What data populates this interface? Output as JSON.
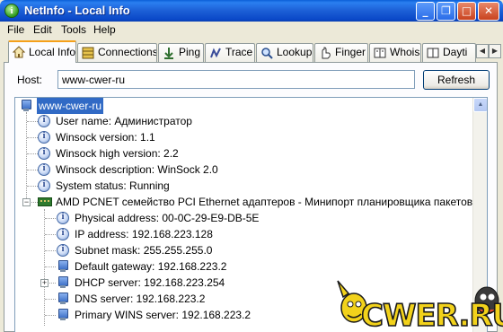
{
  "window": {
    "title": "NetInfo - Local Info"
  },
  "menu": [
    "File",
    "Edit",
    "Tools",
    "Help"
  ],
  "tabs": [
    {
      "label": "Local Info",
      "icon": "home-icon",
      "active": true
    },
    {
      "label": "Connections",
      "icon": "connections-icon"
    },
    {
      "label": "Ping",
      "icon": "ping-icon"
    },
    {
      "label": "Trace",
      "icon": "trace-icon"
    },
    {
      "label": "Lookup",
      "icon": "lookup-icon"
    },
    {
      "label": "Finger",
      "icon": "finger-icon"
    },
    {
      "label": "Whois",
      "icon": "whois-icon"
    },
    {
      "label": "Dayti",
      "icon": "daytime-icon"
    }
  ],
  "host": {
    "label": "Host:",
    "value": "www-cwer-ru"
  },
  "refresh_label": "Refresh",
  "tree": {
    "root": "www-cwer-ru",
    "items": [
      "User name: Администратор",
      "Winsock version: 1.1",
      "Winsock high version: 2.2",
      "Winsock description: WinSock 2.0",
      "System status: Running"
    ],
    "adapter": {
      "label": "AMD PCNET семейство PCI Ethernet адаптеров - Минипорт планировщика пакетов",
      "items": [
        "Physical address: 00-0C-29-E9-DB-5E",
        "IP address: 192.168.223.128",
        "Subnet mask: 255.255.255.0",
        "Default gateway: 192.168.223.2",
        "DHCP server: 192.168.223.254",
        "DNS server: 192.168.223.2",
        "Primary WINS server: 192.168.223.2"
      ]
    }
  },
  "watermark": {
    "text": "CWER.RU"
  },
  "colors": {
    "title_bar": "#0a48c8",
    "selection": "#316ac5",
    "active_tab_accent": "#f5a01a",
    "watermark_yellow": "#f2d21b",
    "watermark_outline": "#1a1a1a"
  }
}
